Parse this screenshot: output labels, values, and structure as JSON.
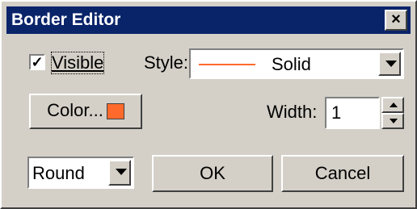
{
  "window": {
    "title": "Border Editor",
    "close_glyph": "×"
  },
  "visible_checkbox": {
    "label": "Visible",
    "checked": true,
    "check_glyph": "✓"
  },
  "style": {
    "label": "Style:",
    "value": "Solid",
    "line_color": "#ff6a2c"
  },
  "color_button": {
    "label": "Color...",
    "swatch_color": "#ff6a2c"
  },
  "width": {
    "label": "Width:",
    "value": "1"
  },
  "join_select": {
    "value": "Round"
  },
  "buttons": {
    "ok": "OK",
    "cancel": "Cancel"
  },
  "icons": {
    "close": "close-icon",
    "dropdown": "chevron-down-icon",
    "spin_up": "arrow-up-icon",
    "spin_down": "arrow-down-icon"
  }
}
